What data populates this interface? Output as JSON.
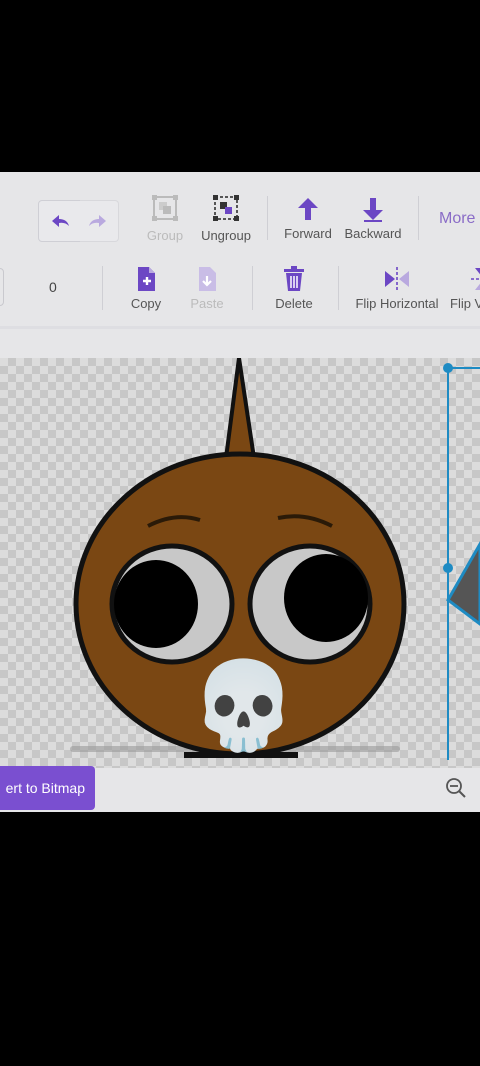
{
  "toolbar_top": {
    "undo_icon": "undo-icon",
    "redo_icon": "redo-icon",
    "group_label": "Group",
    "ungroup_label": "Ungroup",
    "forward_label": "Forward",
    "backward_label": "Backward",
    "more_label": "More"
  },
  "toolbar_bottom": {
    "value": "0",
    "copy_label": "Copy",
    "paste_label": "Paste",
    "delete_label": "Delete",
    "flip_horizontal_label": "Flip Horizontal",
    "flip_vertical_label": "Flip V"
  },
  "bottom_bar": {
    "convert_label": "ert to Bitmap"
  },
  "overlay": {
    "skull_emoji": "💀"
  },
  "colors": {
    "accent": "#7a4fd0",
    "icon": "#6c47c4",
    "selection": "#1e8bc3",
    "character_fill": "#7a4713"
  }
}
